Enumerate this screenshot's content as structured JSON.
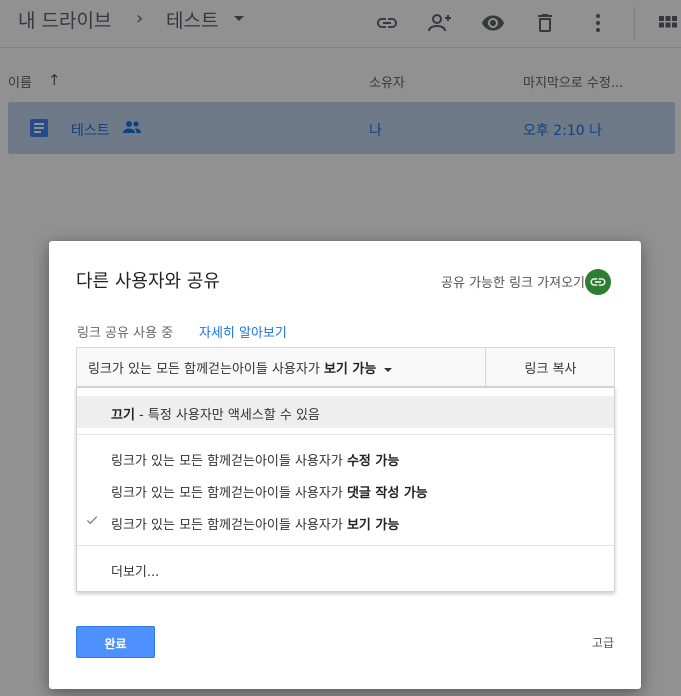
{
  "breadcrumb": {
    "root": "내 드라이브",
    "separator": "›",
    "current": "테스트"
  },
  "columns": {
    "name": "이름",
    "owner": "소유자",
    "modified": "마지막으로 수정..."
  },
  "file": {
    "name": "테스트",
    "owner": "나",
    "modified": "오후 2:10 나"
  },
  "dialog": {
    "title": "다른 사용자와 공유",
    "get_link": "공유 가능한 링크 가져오기",
    "status": "링크 공유 사용 중",
    "learn_more": "자세히 알아보기",
    "permission": {
      "prefix": "링크가 있는 모든 함께걷는아이들 사용자가 ",
      "bold": "보기 가능"
    },
    "copy_link": "링크 복사",
    "menu": {
      "off": {
        "bold": "끄기",
        "rest": " - 특정 사용자만 액세스할 수 있음"
      },
      "options": [
        {
          "prefix": "링크가 있는 모든 함께걷는아이들 사용자가 ",
          "bold": "수정 가능",
          "checked": false
        },
        {
          "prefix": "링크가 있는 모든 함께걷는아이들 사용자가 ",
          "bold": "댓글 작성 가능",
          "checked": false
        },
        {
          "prefix": "링크가 있는 모든 함께걷는아이들 사용자가 ",
          "bold": "보기 가능",
          "checked": true
        }
      ],
      "more": "더보기..."
    },
    "done": "완료",
    "advanced": "고급"
  },
  "colors": {
    "accent": "#1a73e8",
    "selected_row": "#c2d7ee",
    "done_button": "#4d90fe",
    "link_icon": "#2e7d32"
  },
  "icons": [
    "chevron-right-icon",
    "dropdown-caret-icon",
    "link-icon",
    "add-person-icon",
    "eye-icon",
    "trash-icon",
    "more-vert-icon",
    "grid-view-icon",
    "arrow-up-icon",
    "doc-icon",
    "shared-people-icon",
    "check-icon"
  ]
}
